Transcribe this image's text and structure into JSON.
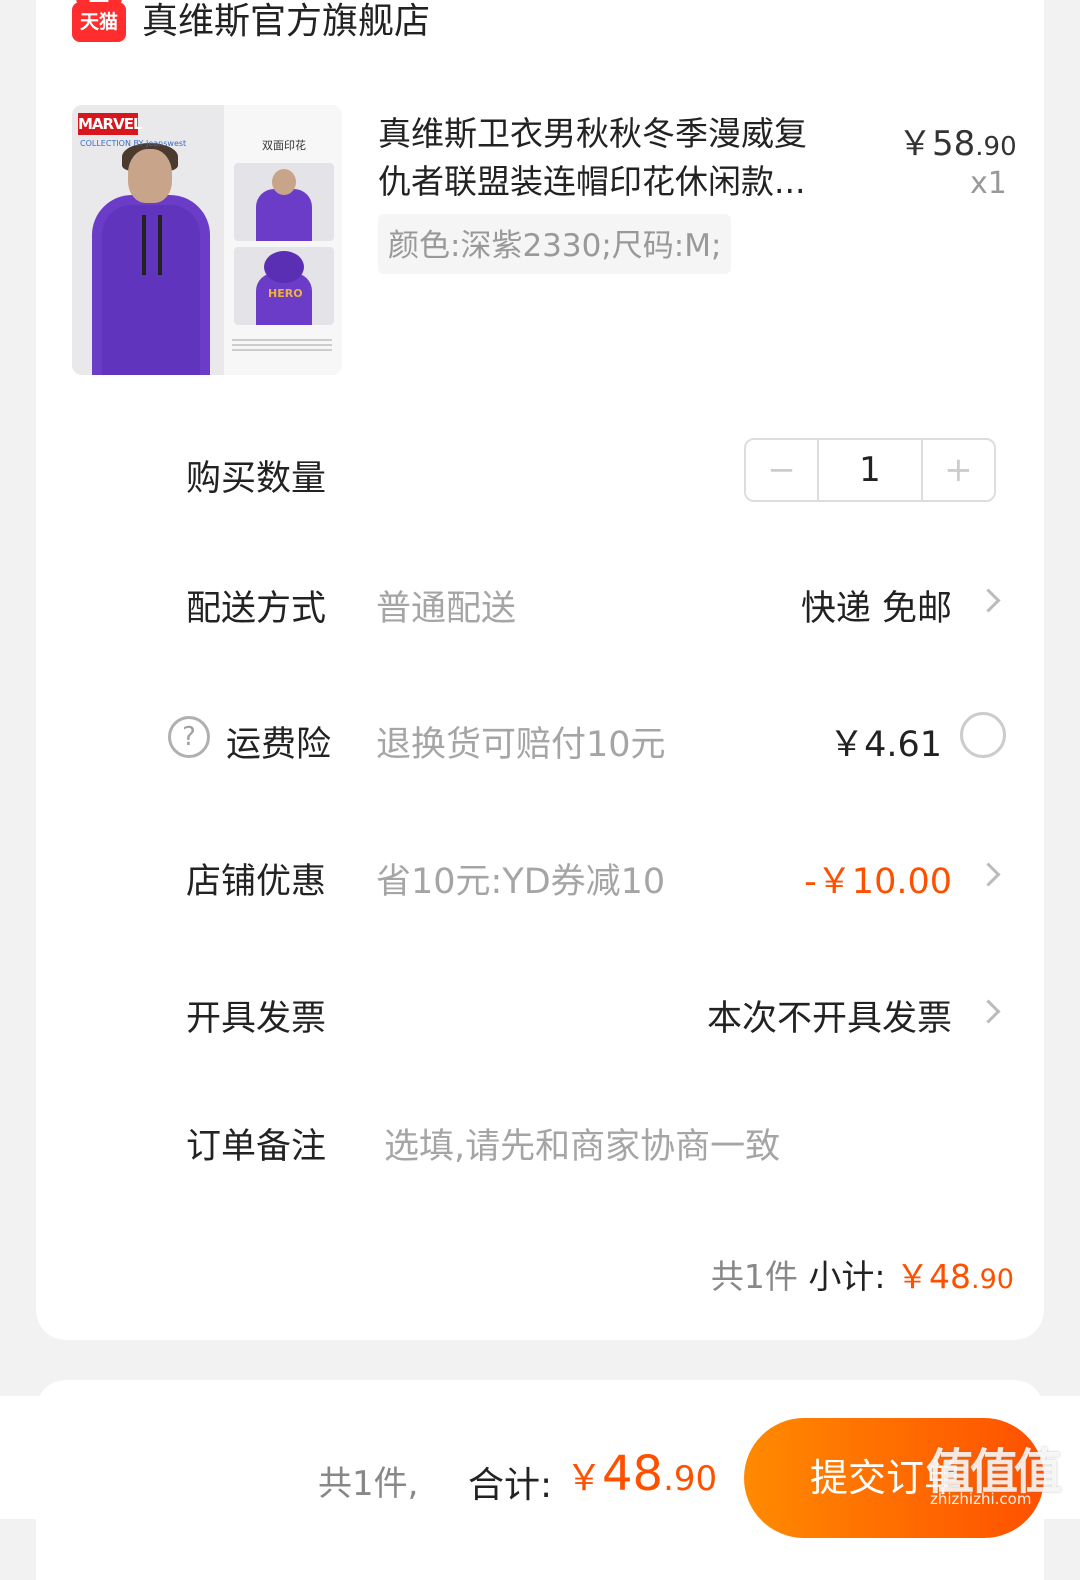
{
  "store": {
    "badge": "天猫",
    "name": "真维斯官方旗舰店"
  },
  "product": {
    "image_texts": {
      "brand": "MARVEL",
      "sub_brand": "COLLECTION BY Jeanswest",
      "panel_title": "双面印花",
      "back_print": "HERO"
    },
    "title_line1": "真维斯卫衣男秋秋冬季漫威复",
    "title_line2": "仇者联盟装连帽印花休闲款...",
    "price_int": "￥58",
    "price_dec": ".90",
    "quantity": "x1",
    "sku": "颜色:深紫2330;尺码:M;"
  },
  "rows": {
    "quantity": {
      "label": "购买数量",
      "minus": "−",
      "value": "1",
      "plus": "+"
    },
    "delivery": {
      "label": "配送方式",
      "sub": "普通配送",
      "value": "快递 免邮"
    },
    "insurance": {
      "label": "运费险",
      "sub": "退换货可赔付10元",
      "value": "￥4.61",
      "help_glyph": "?"
    },
    "store_discount": {
      "label": "店铺优惠",
      "sub": "省10元:YD券减10",
      "value": "-￥10.00"
    },
    "invoice": {
      "label": "开具发票",
      "value": "本次不开具发票"
    },
    "note": {
      "label": "订单备注",
      "placeholder": "选填,请先和商家协商一致"
    }
  },
  "subtotal": {
    "count": "共1件",
    "label": "小计:",
    "amount_int": "￥48",
    "amount_dec": ".90"
  },
  "footer": {
    "count": "共1件,",
    "label": "合计:",
    "yen": "￥",
    "amount_int": "48",
    "amount_dec": ".90",
    "submit": "提交订单"
  },
  "watermark": {
    "text": "值值值",
    "url": "zhizhizhi.com"
  },
  "colors": {
    "accent": "#ff5000",
    "tmall_red": "#ff2d2d",
    "submit_gradient_start": "#ff8a00"
  },
  "icons": [
    "tmall-logo-icon",
    "chevron-right-icon",
    "help-circle-icon",
    "radio-unchecked-icon"
  ]
}
